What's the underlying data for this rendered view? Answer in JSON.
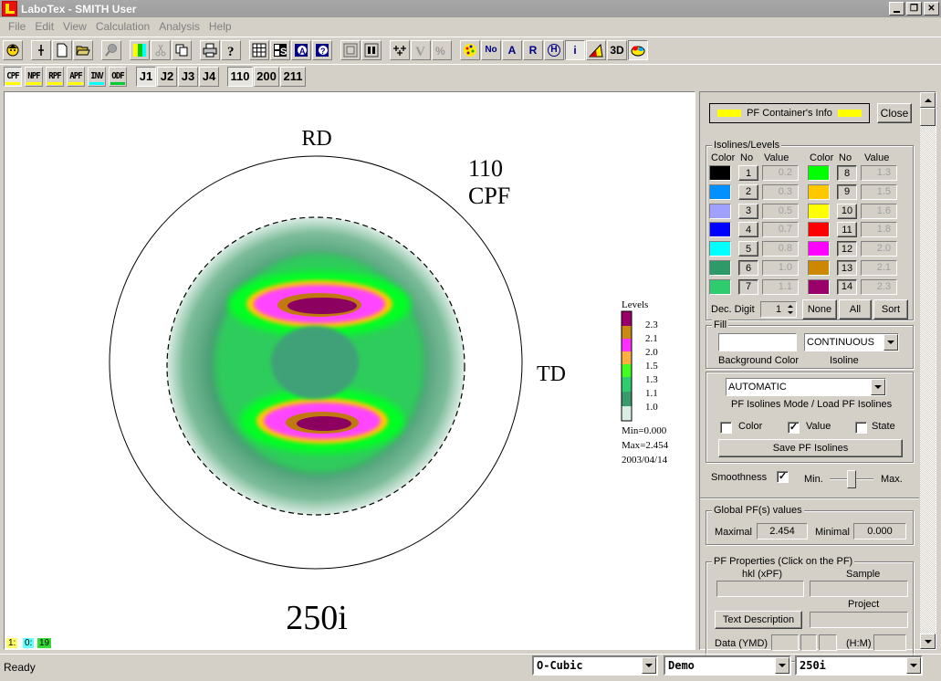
{
  "window": {
    "title": "LaboTex - SMITH User",
    "controls": [
      "_",
      "🗗",
      "✕"
    ]
  },
  "menu": [
    "File",
    "Edit",
    "View",
    "Calculation",
    "Analysis",
    "Help"
  ],
  "toolbar1": {
    "buttons": [
      {
        "icon": "user-icon"
      },
      {
        "icon": "cursor-cross-icon"
      },
      {
        "icon": "new-document-icon"
      },
      {
        "icon": "open-folder-icon"
      },
      {
        "icon": "search-icon"
      },
      {
        "icon": "color-map-icon"
      },
      {
        "icon": "cut-icon"
      },
      {
        "icon": "copy-icon"
      },
      {
        "icon": "print-icon"
      },
      {
        "icon": "help-icon"
      },
      {
        "icon": "grid-icon"
      },
      {
        "icon": "sample-icon"
      },
      {
        "icon": "info-a-icon"
      },
      {
        "icon": "info-q-icon"
      },
      {
        "icon": "single-view-icon"
      },
      {
        "icon": "double-view-icon"
      },
      {
        "icon": "crosses-icon"
      },
      {
        "icon": "v-icon"
      },
      {
        "icon": "percent-icon"
      },
      {
        "icon": "palette-icon"
      },
      {
        "label": "No"
      },
      {
        "label": "A"
      },
      {
        "label": "R"
      },
      {
        "label": "H"
      },
      {
        "label": "i"
      },
      {
        "icon": "triangle-icon"
      },
      {
        "label": "3D"
      },
      {
        "icon": "paint-icon"
      }
    ]
  },
  "toolbar2": {
    "pf_types": [
      {
        "label": "CPF",
        "color": "#ffff00"
      },
      {
        "label": "NPF",
        "color": "#ffff00"
      },
      {
        "label": "RPF",
        "color": "#ffff00"
      },
      {
        "label": "APF",
        "color": "#ffff00"
      },
      {
        "label": "INV",
        "color": "#00ffff"
      },
      {
        "label": "ODF",
        "color": "#00cc33"
      }
    ],
    "j_buttons": [
      "J1",
      "J2",
      "J3",
      "J4"
    ],
    "hkl_buttons": [
      "110",
      "200",
      "211"
    ]
  },
  "pole_figure": {
    "rd_label": "RD",
    "td_label": "TD",
    "hkl": "110",
    "type": "CPF",
    "sample": "250i",
    "legend": {
      "title": "Levels",
      "levels": [
        "2.3",
        "2.1",
        "2.0",
        "1.5",
        "1.3",
        "1.1",
        "1.0"
      ],
      "min": "Min=0.000",
      "max": "Max=2.454",
      "date": "2003/04/14"
    },
    "counters": [
      {
        "text": "1:",
        "color": "#ffff66"
      },
      {
        "text": "0:",
        "color": "#66ffff"
      },
      {
        "text": "19",
        "color": "#33dd33"
      }
    ]
  },
  "panel": {
    "container_info": "PF Container's Info",
    "close": "Close",
    "isolines": {
      "title": "Isolines/Levels",
      "headers": [
        "Color",
        "No",
        "Value"
      ],
      "levels": [
        {
          "no": "1",
          "value": "0.2",
          "color": "#000000",
          "pressed": false
        },
        {
          "no": "2",
          "value": "0.3",
          "color": "#0090ff",
          "pressed": false
        },
        {
          "no": "3",
          "value": "0.5",
          "color": "#a0a0ff",
          "pressed": false
        },
        {
          "no": "4",
          "value": "0.7",
          "color": "#0000ff",
          "pressed": false
        },
        {
          "no": "5",
          "value": "0.8",
          "color": "#00ffff",
          "pressed": false
        },
        {
          "no": "6",
          "value": "1.0",
          "color": "#2e9a6a",
          "pressed": true
        },
        {
          "no": "7",
          "value": "1.1",
          "color": "#2ecc6e",
          "pressed": true
        },
        {
          "no": "8",
          "value": "1.3",
          "color": "#00ff00",
          "pressed": true
        },
        {
          "no": "9",
          "value": "1.5",
          "color": "#ffc800",
          "pressed": true
        },
        {
          "no": "10",
          "value": "1.6",
          "color": "#ffff00",
          "pressed": false
        },
        {
          "no": "11",
          "value": "1.8",
          "color": "#ff0000",
          "pressed": false
        },
        {
          "no": "12",
          "value": "2.0",
          "color": "#ff00ff",
          "pressed": true
        },
        {
          "no": "13",
          "value": "2.1",
          "color": "#cc8800",
          "pressed": true
        },
        {
          "no": "14",
          "value": "2.3",
          "color": "#99006a",
          "pressed": true
        }
      ],
      "dec_digit_label": "Dec. Digit",
      "dec_digit_value": "1",
      "none": "None",
      "all": "All",
      "sort": "Sort"
    },
    "fill": {
      "title": "Fill",
      "background_color_label": "Background Color",
      "isoline_label": "Isoline",
      "isoline_value": "CONTINUOUS"
    },
    "mode": {
      "value": "AUTOMATIC",
      "label": "PF Isolines Mode / Load PF Isolines",
      "color_label": "Color",
      "color_checked": false,
      "value_label": "Value",
      "value_checked": true,
      "state_label": "State",
      "state_checked": false,
      "save": "Save PF Isolines"
    },
    "smoothness": {
      "label": "Smoothness",
      "checked": true,
      "min": "Min.",
      "max": "Max.",
      "level": 0.5
    },
    "global": {
      "title": "Global PF(s) values",
      "maximal_label": "Maximal",
      "maximal": "2.454",
      "minimal_label": "Minimal",
      "minimal": "0.000"
    },
    "properties": {
      "title": "PF Properties  (Click on the PF)",
      "hkl_label": "hkl  (xPF)",
      "sample_label": "Sample",
      "project_label": "Project",
      "text_description": "Text  Description",
      "date_label": "Data (YMD)",
      "time_label": "(H:M)"
    }
  },
  "statusbar": {
    "text": "Ready",
    "crystal": "O-Cubic",
    "project": "Demo",
    "sample": "250i"
  }
}
